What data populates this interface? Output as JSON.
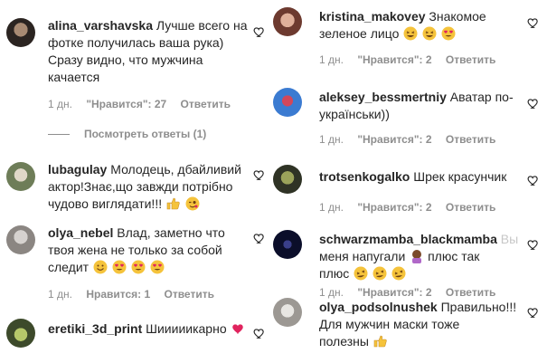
{
  "left": [
    {
      "username": "alina_varshavska",
      "lines": [
        "Лучше всего на",
        "фотке получилась ваша рука)",
        "Сразу видно, что мужчина",
        "качается"
      ],
      "time": "1 дн.",
      "likes": "\"Нравится\": 27",
      "reply": "Ответить",
      "replies_label": "Посмотреть ответы (1)"
    },
    {
      "username": "lubagulay",
      "lines": [
        "Молодець, дбайливий",
        "актор!Знає,що завжди потрібно",
        "чудово виглядати!!!"
      ],
      "time": "",
      "likes": "",
      "reply": ""
    },
    {
      "username": "olya_nebel",
      "lines": [
        "Влад, заметно что",
        "твоя жена не только за собой",
        "следит"
      ],
      "time": "1 дн.",
      "likes": "Нравится: 1",
      "reply": "Ответить"
    },
    {
      "username": "eretiki_3d_print",
      "lines": [
        "Шииииикарно"
      ]
    }
  ],
  "right": [
    {
      "username": "kristina_makovey",
      "lines": [
        "Знакомое",
        "зеленое лицо"
      ],
      "time": "1 дн.",
      "likes": "\"Нравится\": 2",
      "reply": "Ответить"
    },
    {
      "username": "aleksey_bessmertniy",
      "lines": [
        "Аватар по-",
        "українськи))"
      ],
      "time": "1 дн.",
      "likes": "\"Нравится\": 2",
      "reply": "Ответить"
    },
    {
      "username": "trotsenkogalko",
      "lines": [
        "Шрек красунчик"
      ],
      "time": "1 дн.",
      "likes": "\"Нравится\": 2",
      "reply": "Ответить"
    },
    {
      "username": "schwarzmamba_blackmamba",
      "lines": [
        "Вы",
        "меня напугали",
        "плюс так",
        "плюс"
      ],
      "time": "1 дн.",
      "likes": "\"Нравится\": 2",
      "reply": "Ответить"
    },
    {
      "username": "olya_podsolnushek",
      "lines": [
        "Правильно!!!",
        "Для мужчин маски тоже",
        "полезны"
      ]
    }
  ],
  "colors": {
    "text": "#262626",
    "meta": "#8e8e8e",
    "emoji_yellow": "#f5c33b",
    "heart_red": "#e0245e"
  }
}
